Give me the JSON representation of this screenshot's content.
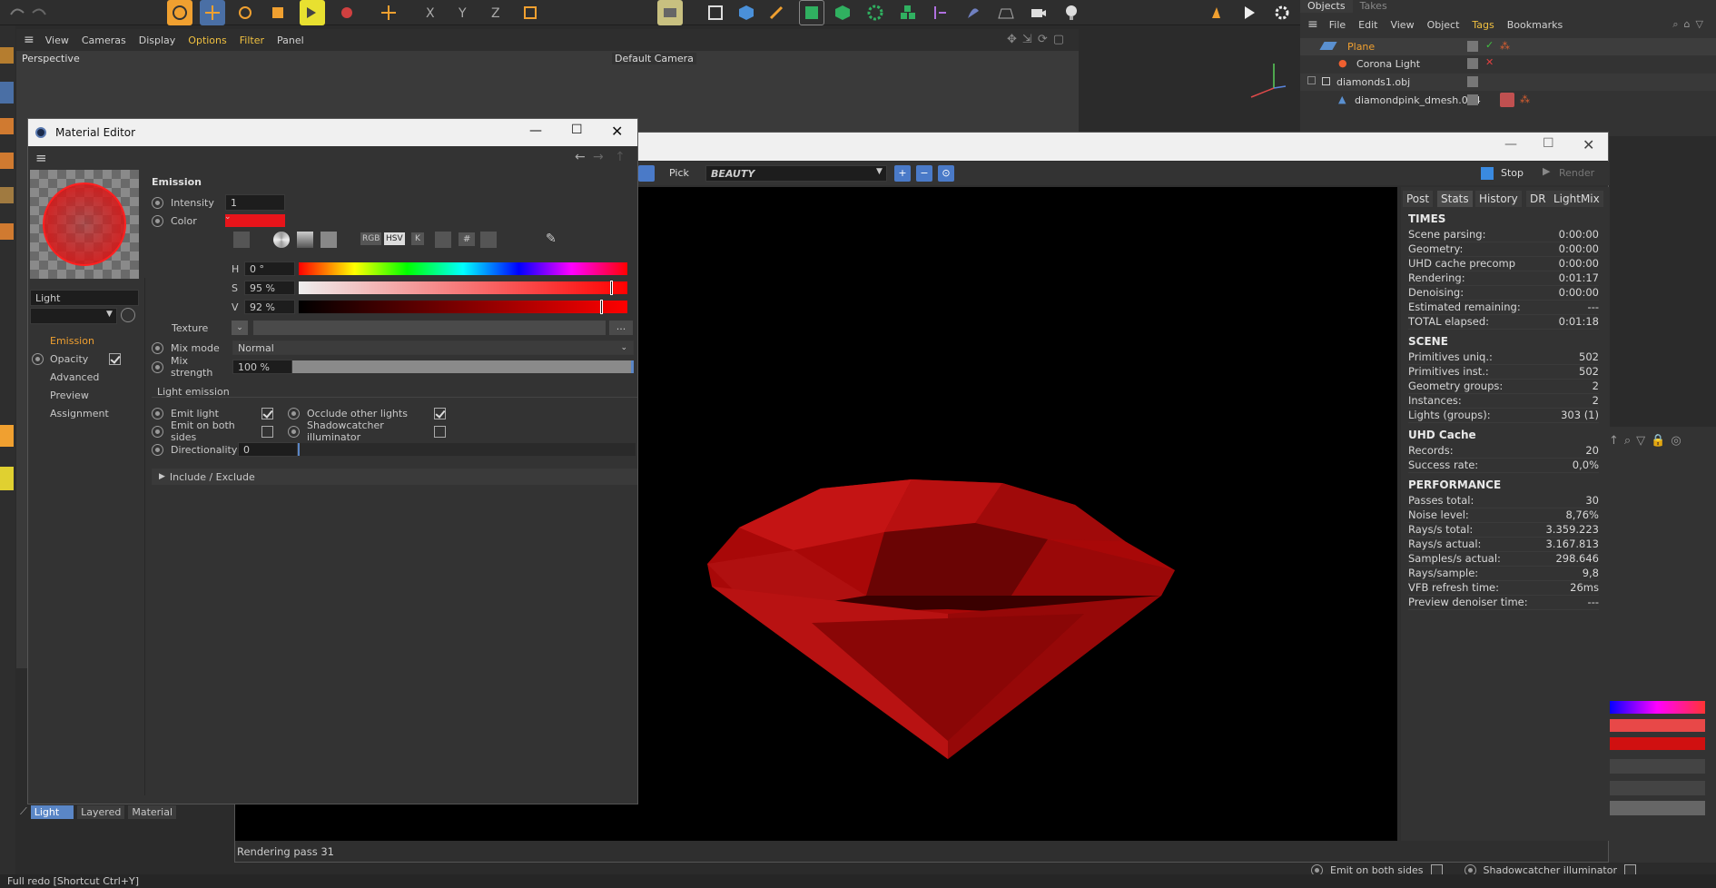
{
  "main_menu": [
    "View",
    "Cameras",
    "Display",
    "Options",
    "Filter",
    "Panel"
  ],
  "viewport": {
    "label": "Perspective",
    "camera": "Default Camera"
  },
  "objects_panel": {
    "tabs": [
      "Objects",
      "Takes"
    ],
    "menu": [
      "File",
      "Edit",
      "View",
      "Object",
      "Tags",
      "Bookmarks"
    ],
    "items": [
      {
        "name": "Plane",
        "color": "#f0a030"
      },
      {
        "name": "Corona Light",
        "color": "#d8d8d8"
      },
      {
        "name": "diamonds1.obj",
        "color": "#d8d8d8"
      },
      {
        "name": "diamondpink_dmesh.004",
        "color": "#d8d8d8"
      }
    ]
  },
  "material_editor": {
    "title": "Material Editor",
    "name_value": "Light",
    "channels": [
      "Emission",
      "Opacity",
      "Advanced",
      "Preview",
      "Assignment"
    ],
    "section_title": "Emission",
    "intensity_label": "Intensity",
    "intensity_value": "1",
    "color_label": "Color",
    "color_hex": "#e8141a",
    "mode_buttons": [
      "RGB",
      "HSV",
      "K",
      "#"
    ],
    "h_label": "H",
    "h_value": "0 °",
    "s_label": "S",
    "s_value": "95 %",
    "v_label": "V",
    "v_value": "92 %",
    "texture_label": "Texture",
    "texture_button": "...",
    "mixmode_label": "Mix mode",
    "mixmode_value": "Normal",
    "mixstrength_label": "Mix strength",
    "mixstrength_value": "100 %",
    "light_emission_title": "Light emission",
    "emit_light_label": "Emit light",
    "occlude_label": "Occlude other lights",
    "emit_both_label": "Emit on both sides",
    "shadowcatcher_label": "Shadowcatcher illuminator",
    "directionality_label": "Directionality",
    "directionality_value": "0",
    "include_label": "Include / Exclude",
    "bottom_tabs": [
      "Light",
      "Layered",
      "Material"
    ]
  },
  "vfb": {
    "pick_label": "Pick",
    "pass_value": "BEAUTY",
    "stop_label": "Stop",
    "render_label": "Render",
    "tabs": [
      "Post",
      "Stats",
      "History",
      "DR",
      "LightMix"
    ],
    "status": "Rendering pass 31",
    "stats": {
      "times_title": "TIMES",
      "times": [
        [
          "Scene parsing:",
          "0:00:00"
        ],
        [
          "Geometry:",
          "0:00:00"
        ],
        [
          "UHD cache precomp",
          "0:00:00"
        ],
        [
          "Rendering:",
          "0:01:17"
        ],
        [
          "Denoising:",
          "0:00:00"
        ],
        [
          "Estimated remaining:",
          "---"
        ],
        [
          "TOTAL elapsed:",
          "0:01:18"
        ]
      ],
      "scene_title": "SCENE",
      "scene": [
        [
          "Primitives uniq.:",
          "502"
        ],
        [
          "Primitives inst.:",
          "502"
        ],
        [
          "Geometry groups:",
          "2"
        ],
        [
          "Instances:",
          "2"
        ],
        [
          "Lights (groups):",
          "303 (1)"
        ]
      ],
      "uhd_title": "UHD Cache",
      "uhd": [
        [
          "Records:",
          "20"
        ],
        [
          "Success rate:",
          "0,0%"
        ]
      ],
      "perf_title": "PERFORMANCE",
      "perf": [
        [
          "Passes total:",
          "30"
        ],
        [
          "Noise level:",
          "8,76%"
        ],
        [
          "Rays/s total:",
          "3.359.223"
        ],
        [
          "Rays/s actual:",
          "3.167.813"
        ],
        [
          "Samples/s actual:",
          "298.646"
        ],
        [
          "Rays/sample:",
          "9,8"
        ],
        [
          "VFB refresh time:",
          "26ms"
        ],
        [
          "Preview denoiser time:",
          "---"
        ]
      ]
    }
  },
  "bg_panel": {
    "emit_both_label": "Emit on both sides",
    "shadowcatcher_label": "Shadowcatcher illuminator"
  },
  "statusbar": "Full redo [Shortcut Ctrl+Y]",
  "colors": {
    "accent": "#f0a030",
    "emission": "#e8141a",
    "highlight": "#5a86c6"
  }
}
